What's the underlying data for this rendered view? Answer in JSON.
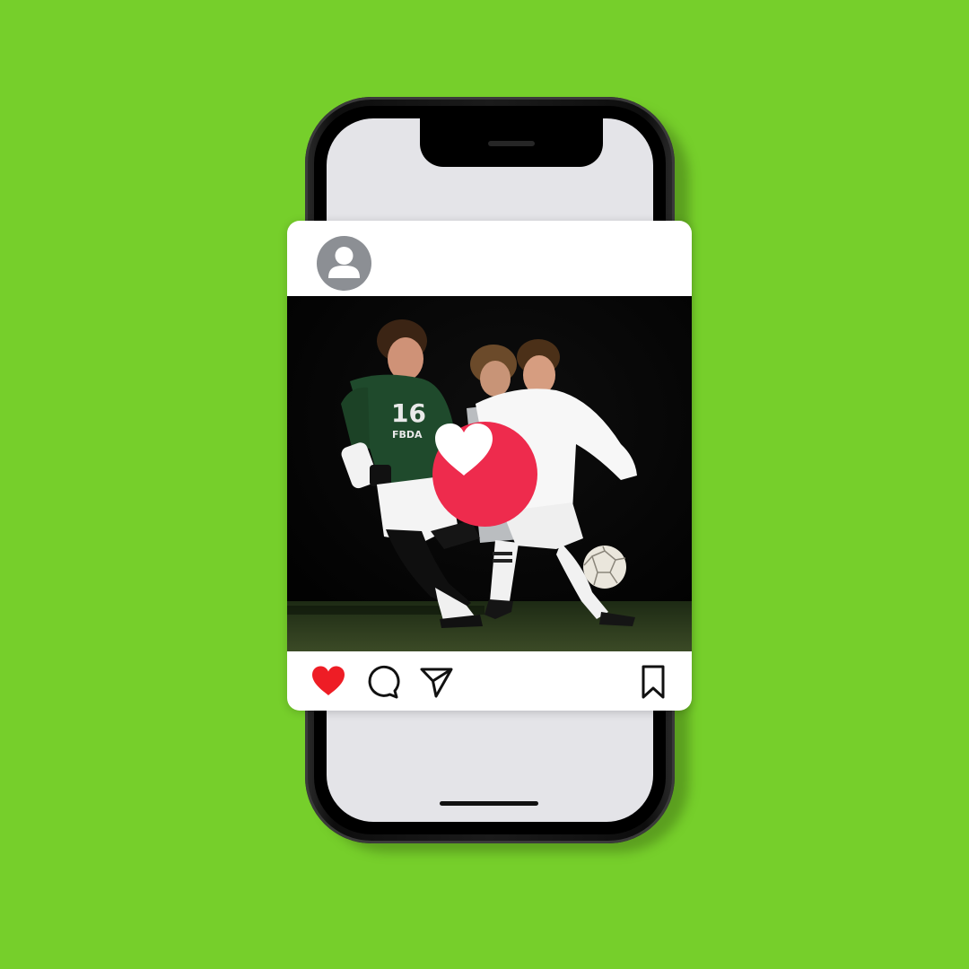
{
  "background_color": "#76cf2b",
  "phone": {
    "frame_color": "#111111",
    "screen_color": "#e4e4e8"
  },
  "post": {
    "image": {
      "subject": "soccer-players",
      "jersey_number": "16",
      "jersey_text": "FBDA"
    },
    "like_overlay_color": "#ee2b4d",
    "actions": {
      "like_icon": "heart-icon",
      "like_state": "liked",
      "like_color": "#ee1d25",
      "comment_icon": "comment-icon",
      "share_icon": "send-icon",
      "save_icon": "bookmark-icon"
    },
    "avatar_icon": "user-icon"
  }
}
